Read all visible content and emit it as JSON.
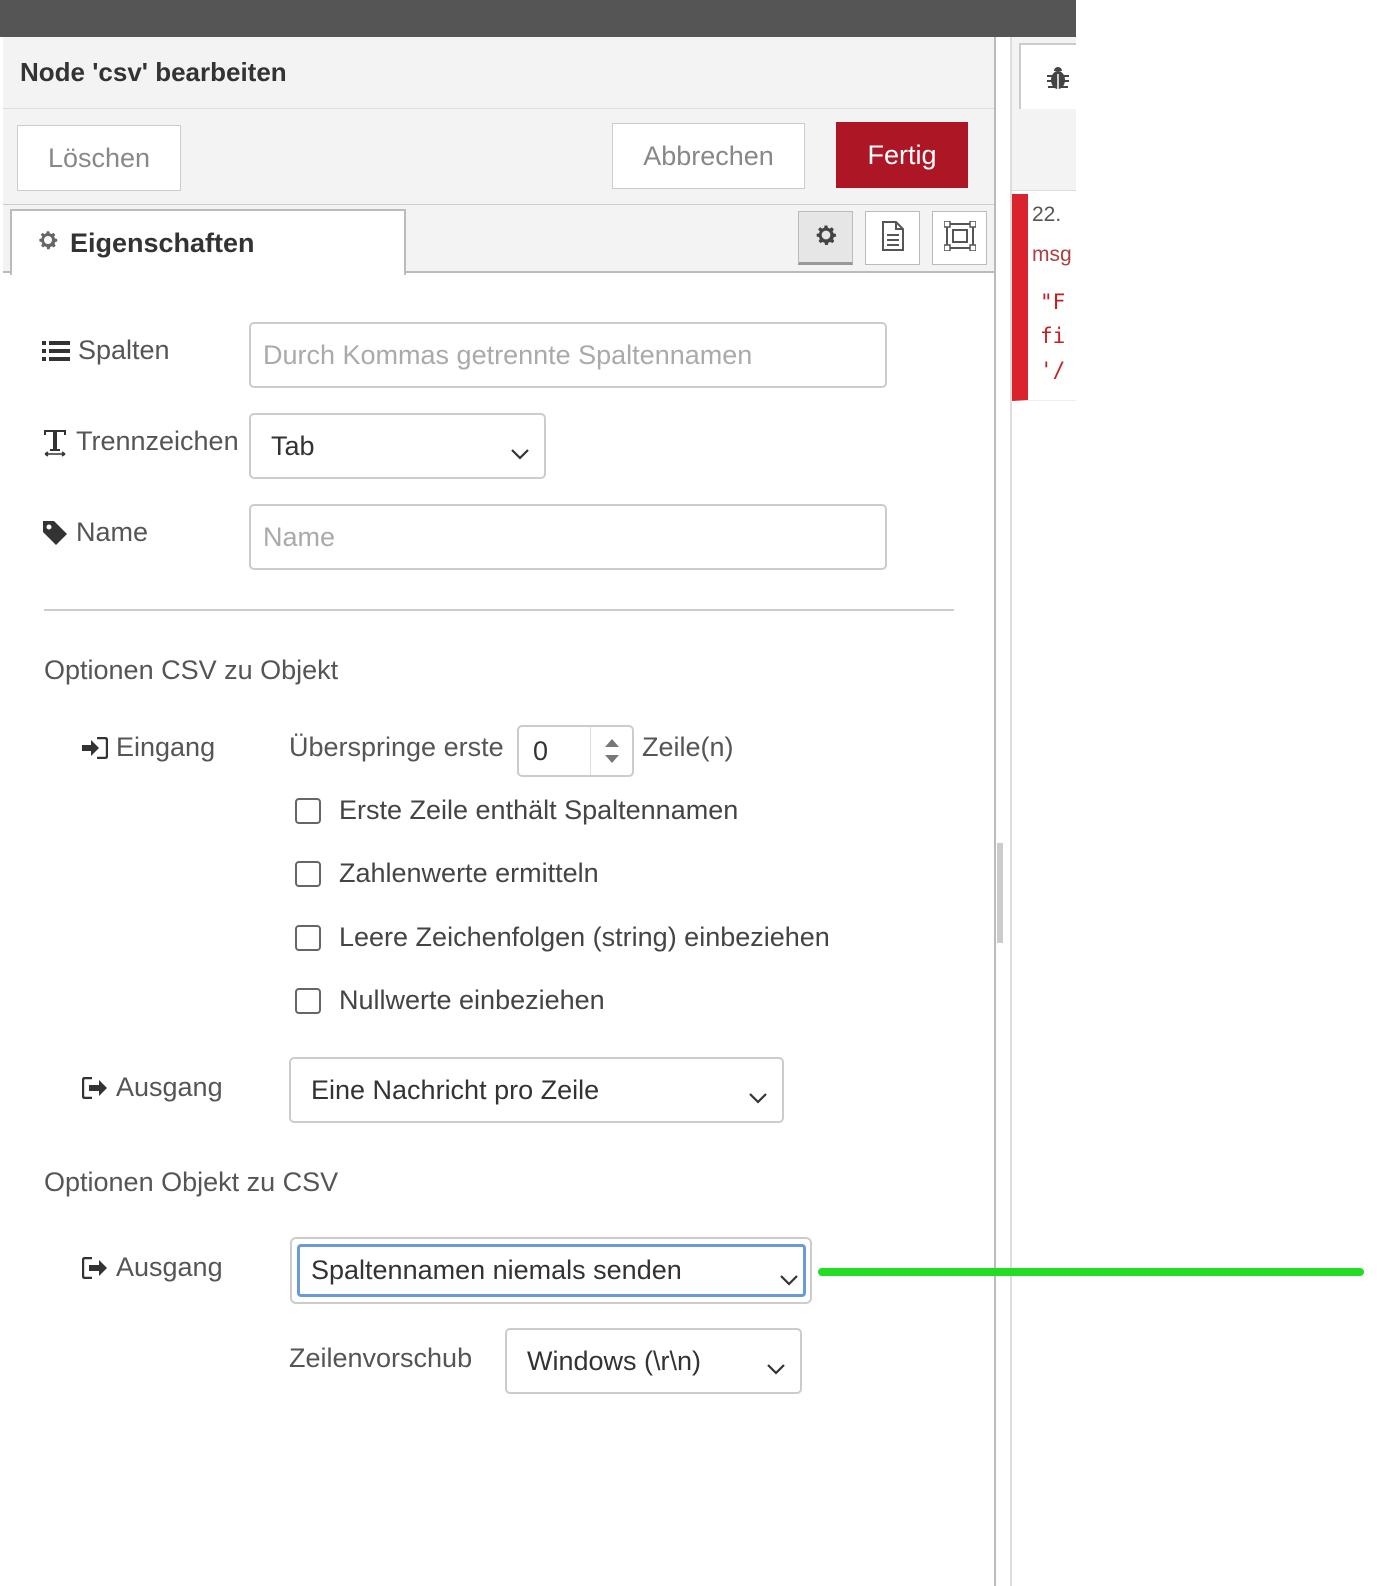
{
  "editor": {
    "title": "Node 'csv' bearbeiten",
    "buttons": {
      "delete": "Löschen",
      "cancel": "Abbrechen",
      "done": "Fertig"
    },
    "tab": "Eigenschaften",
    "tab_icons": [
      "gear-icon",
      "document-icon",
      "appearance-icon"
    ]
  },
  "form": {
    "columns": {
      "label": "Spalten",
      "placeholder": "Durch Kommas getrennte Spaltennamen",
      "value": ""
    },
    "separator": {
      "label": "Trennzeichen",
      "value": "Tab"
    },
    "name": {
      "label": "Name",
      "placeholder": "Name",
      "value": ""
    },
    "csv_to_object": {
      "heading": "Optionen CSV zu Objekt",
      "input_label": "Eingang",
      "skip_prefix": "Überspringe erste",
      "skip_value": "0",
      "skip_suffix": "Zeile(n)",
      "checkboxes": [
        {
          "label": "Erste Zeile enthält Spaltennamen",
          "checked": false
        },
        {
          "label": "Zahlenwerte ermitteln",
          "checked": false
        },
        {
          "label": "Leere Zeichenfolgen (string) einbeziehen",
          "checked": false
        },
        {
          "label": "Nullwerte einbeziehen",
          "checked": false
        }
      ],
      "output_label": "Ausgang",
      "output_value": "Eine Nachricht pro Zeile"
    },
    "object_to_csv": {
      "heading": "Optionen Objekt zu CSV",
      "output_label": "Ausgang",
      "output_value": "Spaltennamen niemals senden",
      "newline_label": "Zeilenvorschub",
      "newline_value": "Windows (\\r\\n)"
    }
  },
  "sidebar": {
    "tab_icon": "bug-icon",
    "msg_time": "22.",
    "msg_topic": "msg",
    "msg_lines": [
      "\"F",
      "fi",
      "'/"
    ]
  },
  "colors": {
    "primary": "#ad1625",
    "error": "#d9242d",
    "focus": "#6a9bd8",
    "annotation": "#22dd22"
  }
}
